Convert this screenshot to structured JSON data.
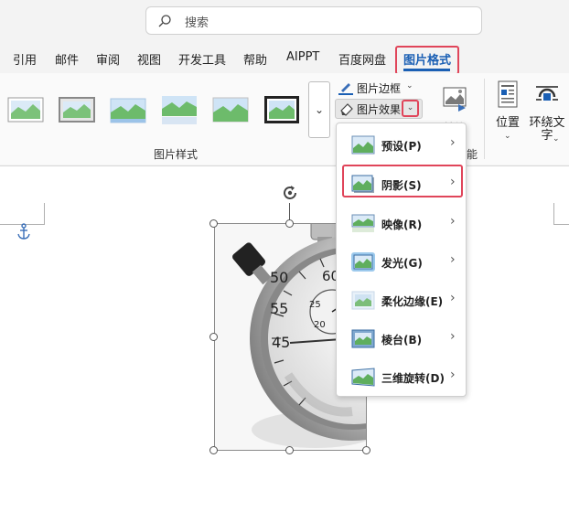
{
  "search": {
    "placeholder": "搜索"
  },
  "tabs": [
    {
      "label": "引用"
    },
    {
      "label": "邮件"
    },
    {
      "label": "审阅"
    },
    {
      "label": "视图"
    },
    {
      "label": "开发工具"
    },
    {
      "label": "帮助"
    },
    {
      "label": "AIPPT"
    },
    {
      "label": "百度网盘"
    },
    {
      "label": "图片格式",
      "active": true
    }
  ],
  "ribbon": {
    "gallery_more": "⌄",
    "picture_styles_group": "图片样式",
    "picture_border": "图片边框",
    "picture_effects": "图片效果",
    "replace": "替换",
    "replace_group_partial": "能",
    "position": "位置",
    "wrap_text": "环绕文字"
  },
  "effects_menu": {
    "items": [
      {
        "label": "预设(P)"
      },
      {
        "label": "阴影(S)",
        "highlighted": true
      },
      {
        "label": "映像(R)"
      },
      {
        "label": "发光(G)"
      },
      {
        "label": "柔化边缘(E)"
      },
      {
        "label": "棱台(B)"
      },
      {
        "label": "三维旋转(D)"
      }
    ]
  },
  "stopwatch_numbers": [
    "55",
    "50",
    "45",
    "60",
    "25",
    "20"
  ],
  "colors": {
    "accent": "#1a5fb4",
    "highlight": "#e0455a"
  }
}
